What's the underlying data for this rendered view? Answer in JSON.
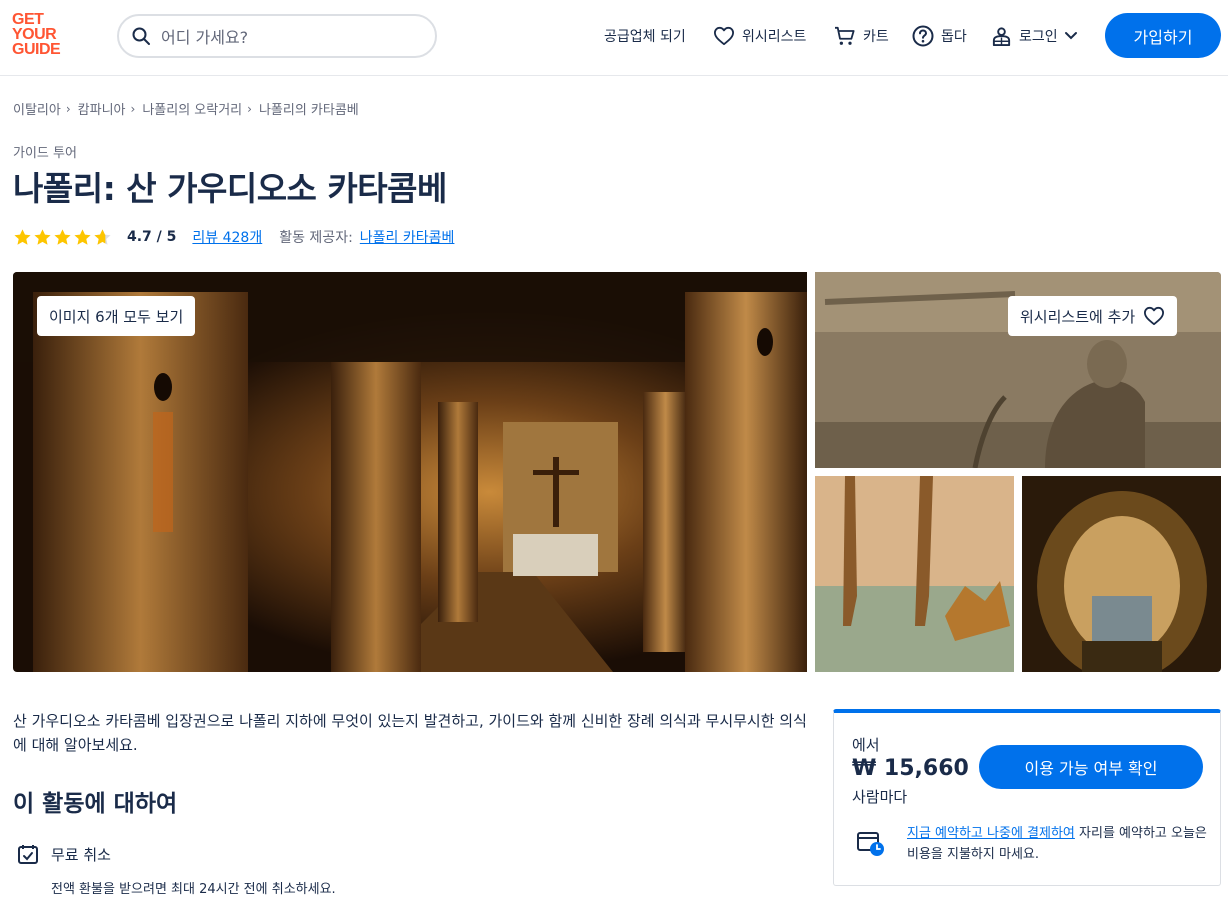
{
  "header": {
    "logo_lines": [
      "GET",
      "YOUR",
      "GUIDE"
    ],
    "search_placeholder": "어디 가세요?",
    "supplier": "공급업체 되기",
    "wishlist": "위시리스트",
    "cart": "카트",
    "help": "돕다",
    "login": "로그인",
    "signup": "가입하기"
  },
  "breadcrumb": [
    "이탈리아",
    "캄파니아",
    "나폴리의 오락거리",
    "나폴리의 카타콤베"
  ],
  "category": "가이드 투어",
  "title": "나폴리: 산 가우디오소 카타콤베",
  "rating": {
    "stars_value": 4.7,
    "score": "4.7 / 5",
    "reviews": "리뷰 428개",
    "provider_label": "활동 제공자:",
    "provider_name": "나폴리 카타콤베"
  },
  "gallery": {
    "view_all": "이미지 6개 모두 보기",
    "wishlist_add": "위시리스트에 추가"
  },
  "description": "산 가우디오소 카타콤베 입장권으로 나폴리 지하에 무엇이 있는지 발견하고, 가이드와 함께 신비한 장례 의식과 무시무시한 의식에 대해 알아보세요.",
  "about": {
    "title": "이 활동에 대하여",
    "feature_title": "무료 취소",
    "feature_sub": "전액 환불을 받으려면 최대 24시간 전에 취소하세요."
  },
  "booking": {
    "from": "에서",
    "price": "₩ 15,660",
    "per_person": "사람마다",
    "check_button": "이용 가능 여부 확인",
    "reserve_link": "지금 예약하고 나중에 결제하여",
    "reserve_rest": " 자리를 예약하고 오늘은 비용을 지불하지 마세요."
  },
  "colors": {
    "brand_orange": "#ff5533",
    "primary_blue": "#0071eb",
    "text_dark": "#1a2b49",
    "star": "#fdc500"
  }
}
